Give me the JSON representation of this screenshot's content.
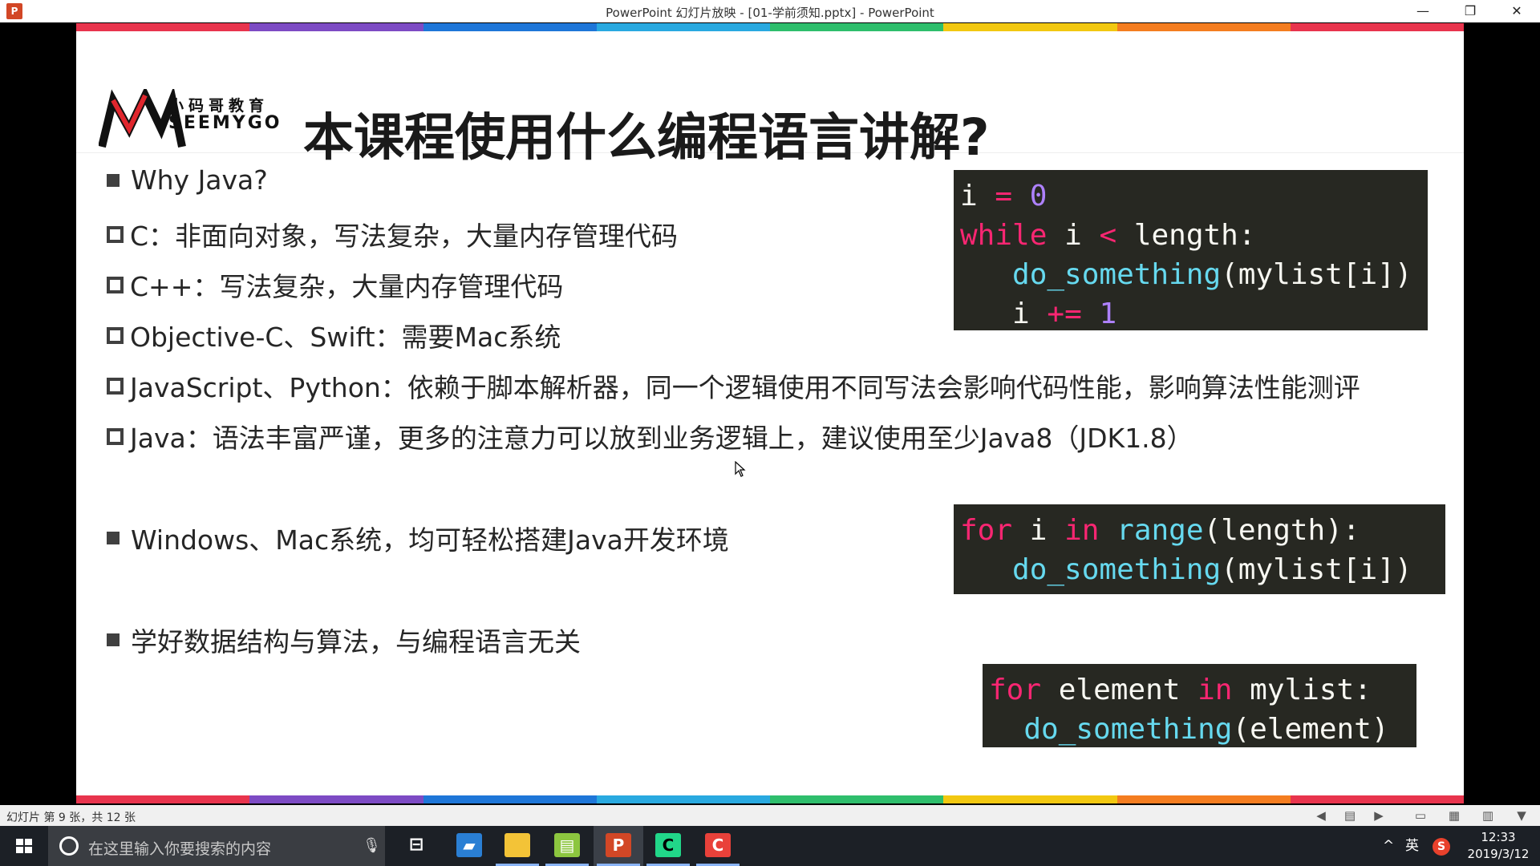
{
  "window": {
    "title": "PowerPoint 幻灯片放映 - [01-学前须知.pptx] - PowerPoint",
    "app_icon": "P",
    "minimize_glyph": "—",
    "maximize_glyph": "❐",
    "close_glyph": "✕"
  },
  "slide": {
    "logo_cn": "小码哥教育",
    "logo_en": "SEEMYGO",
    "title": "本课程使用什么编程语言讲解?",
    "bullets": [
      "Why Java?",
      "C：非面向对象，写法复杂，大量内存管理代码",
      "C++：写法复杂，大量内存管理代码",
      "Objective-C、Swift：需要Mac系统",
      "JavaScript、Python：依赖于脚本解析器，同一个逻辑使用不同写法会影响代码性能，影响算法性能测评",
      "Java：语法丰富严谨，更多的注意力可以放到业务逻辑上，建议使用至少Java8（JDK1.8）",
      "Windows、Mac系统，均可轻松搭建Java开发环境",
      "学好数据结构与算法，与编程语言无关"
    ],
    "code": {
      "block1": {
        "l1_var": "i",
        "l1_op": "=",
        "l1_num": "0",
        "l2_kw": "while",
        "l2_var": "i",
        "l2_op": "<",
        "l2_rest": "length:",
        "l3_fn": "do_something",
        "l3_rest": "(mylist[i])",
        "l4_var": "i",
        "l4_op": "+=",
        "l4_num": "1"
      },
      "block2": {
        "l1_kw1": "for",
        "l1_var": "i",
        "l1_kw2": "in",
        "l1_fn": "range",
        "l1_rest": "(length):",
        "l2_fn": "do_something",
        "l2_rest": "(mylist[i])"
      },
      "block3": {
        "l1_kw1": "for",
        "l1_var": "element",
        "l1_kw2": "in",
        "l1_rest": "mylist:",
        "l2_fn": "do_something",
        "l2_rest": "(element)"
      }
    },
    "rainbow_colors": [
      "#e8344d",
      "#7d4bc4",
      "#1e76d8",
      "#29a9e0",
      "#2ebe6c",
      "#f2c811",
      "#f47d20",
      "#e8344d"
    ]
  },
  "statusbar": {
    "slide_count": "幻灯片 第 9 张，共 12 张"
  },
  "taskbar": {
    "search_placeholder": "在这里输入你要搜索的内容",
    "tray_lang": "英",
    "time": "12:33",
    "date": "2019/3/12"
  }
}
